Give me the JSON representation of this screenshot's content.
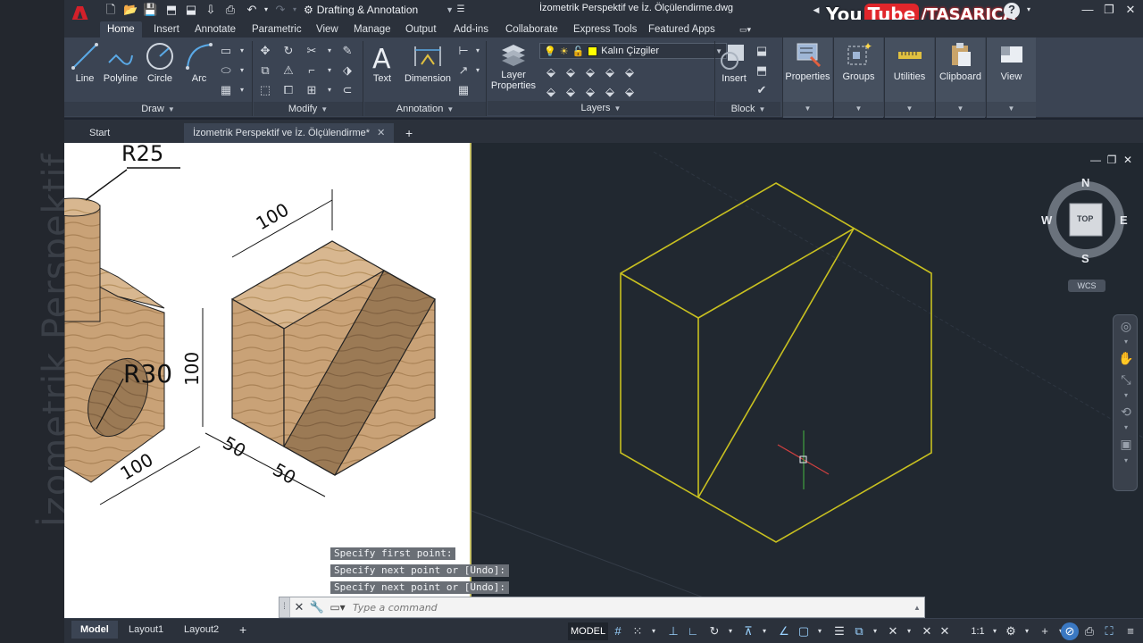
{
  "watermark": "İzometrik Perspektif",
  "titlebar": {
    "workspace": "Drafting & Annotation",
    "doc_title": "İzometrik Perspektif ve İz. Ölçülendirme.dwg",
    "youtube": {
      "you": "You",
      "tube": "Tube",
      "channel": "/TASARICA"
    }
  },
  "ribbon_tabs": [
    "Home",
    "Insert",
    "Annotate",
    "Parametric",
    "View",
    "Manage",
    "Output",
    "Add-ins",
    "Collaborate",
    "Express Tools",
    "Featured Apps"
  ],
  "panels": {
    "draw": {
      "title": "Draw",
      "tools": [
        "Line",
        "Polyline",
        "Circle",
        "Arc"
      ]
    },
    "modify": {
      "title": "Modify"
    },
    "annotation": {
      "title": "Annotation",
      "tools": [
        "Text",
        "Dimension"
      ]
    },
    "layers": {
      "title": "Layers",
      "tool": "Layer Properties",
      "current_layer": "Kalın Çizgiler",
      "layer_color": "#ffff00"
    },
    "block": {
      "title": "Block",
      "tool": "Insert"
    },
    "groups": [
      "Properties",
      "Groups",
      "Utilities",
      "Clipboard",
      "View"
    ]
  },
  "file_tabs": {
    "start": "Start",
    "active": "İzometrik Perspektif ve İz. Ölçülendirme*",
    "close_glyph": "✕",
    "add_glyph": "+"
  },
  "reference": {
    "dims": {
      "r25": "R25",
      "r30": "R30",
      "d100_top": "100",
      "d100_left": "100",
      "d100_bottom": "100",
      "d50_a": "50",
      "d50_b": "50"
    }
  },
  "viewcube": {
    "n": "N",
    "s": "S",
    "e": "E",
    "w": "W",
    "face": "TOP",
    "wcs": "WCS"
  },
  "command_history": [
    "Specify first point:",
    "Specify next point or [Undo]:",
    "Specify next point or [Undo]:"
  ],
  "command": {
    "placeholder": "Type a command"
  },
  "status": {
    "layout_tabs": [
      "Model",
      "Layout1",
      "Layout2"
    ],
    "model_label": "MODEL",
    "scale": "1:1"
  },
  "colors": {
    "accent_yellow": "#c8c020",
    "crosshair_red": "#d04040",
    "crosshair_green": "#40a040"
  }
}
